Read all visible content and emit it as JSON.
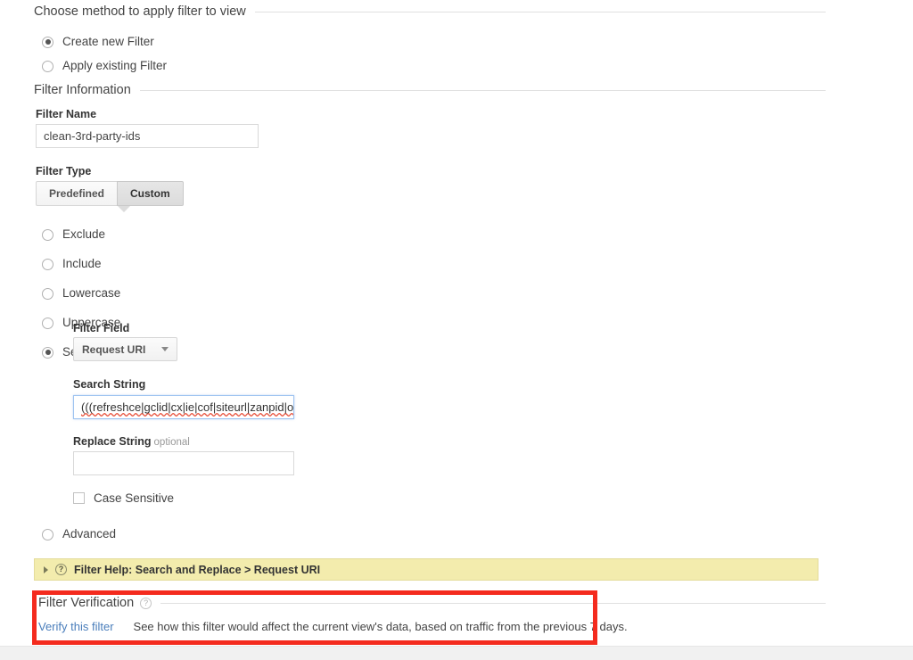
{
  "method_section": {
    "heading": "Choose method to apply filter to view",
    "options": [
      {
        "label": "Create new Filter",
        "selected": true
      },
      {
        "label": "Apply existing Filter",
        "selected": false
      }
    ]
  },
  "filter_information": {
    "heading": "Filter Information",
    "filter_name": {
      "label": "Filter Name",
      "value": "clean-3rd-party-ids"
    },
    "filter_type": {
      "label": "Filter Type",
      "tabs": [
        {
          "label": "Predefined",
          "active": false
        },
        {
          "label": "Custom",
          "active": true
        }
      ]
    },
    "custom_options": [
      {
        "label": "Exclude",
        "selected": false
      },
      {
        "label": "Include",
        "selected": false
      },
      {
        "label": "Lowercase",
        "selected": false
      },
      {
        "label": "Uppercase",
        "selected": false
      },
      {
        "label": "Search and Replace",
        "selected": true
      },
      {
        "label": "Advanced",
        "selected": false
      }
    ],
    "filter_field": {
      "label": "Filter Field",
      "selected": "Request URI"
    },
    "search_string": {
      "label": "Search String",
      "value": "(((refreshce|gclid|cx|ie|cof|siteurl|zanpid|origi"
    },
    "replace_string": {
      "label": "Replace String",
      "optional_suffix": "optional",
      "value": "",
      "placeholder": ""
    },
    "case_sensitive": {
      "label": "Case Sensitive",
      "checked": false
    }
  },
  "help_bar": {
    "expander": "collapsed",
    "help_icon": "?",
    "text": "Filter Help: Search and Replace  >  Request URI"
  },
  "filter_verification": {
    "heading": "Filter Verification",
    "help_icon": "?",
    "link": "Verify this filter",
    "description": "See how this filter would affect the current view's data, based on traffic from the previous 7 days."
  },
  "colors": {
    "annotation_red": "#f42b1e",
    "help_bar_yellow": "#f3ecad",
    "link_blue": "#4a7ebb",
    "footer_gray": "#f1f1f1"
  }
}
